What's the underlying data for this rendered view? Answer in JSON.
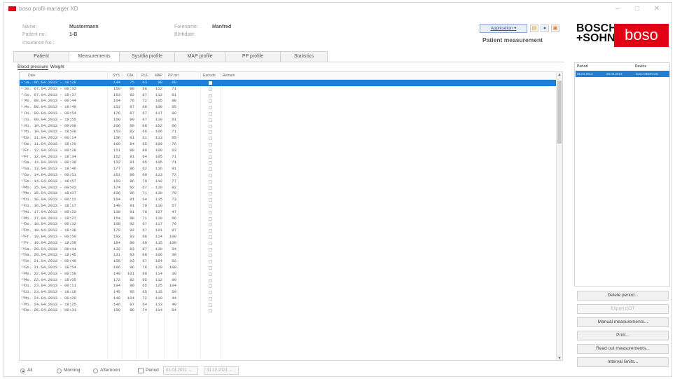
{
  "window": {
    "title": "boso profil-manager XD"
  },
  "patient": {
    "name_label": "Name:",
    "name_value": "Mustermann",
    "patient_no_label": "Patient no.:",
    "patient_no_value": "1-B",
    "insurance_label": "Insurance No.:",
    "forename_label": "Forename:",
    "forename_value": "Manfred",
    "birthdate_label": "Birthdate:"
  },
  "toolbar": {
    "application_label": "Application ▾",
    "section_title": "Patient measurement"
  },
  "brand": {
    "bosch_line1": "BOSCH",
    "bosch_line2": "+SOHN",
    "boso": "boso",
    "color": "#e20015"
  },
  "tabs": [
    "Patient",
    "Measurements",
    "Sys/dia profile",
    "MAP profile",
    "PP profile",
    "Statistics"
  ],
  "active_tab": "Measurements",
  "subtabs": {
    "blood_pressure": "Blood pressure",
    "weight": "Weight"
  },
  "table": {
    "columns": {
      "date": "Date",
      "sys": "SYS",
      "dia": "DIA",
      "pul": "PUL",
      "map": "MAP",
      "pp": "PP mm",
      "exclude": "Exclude",
      "remark": "Remark"
    },
    "rows": [
      {
        "idx": "1",
        "date": "Sa. 06.04.2013 - 10:28",
        "sys": "144",
        "dia": "75",
        "pul": "63",
        "map": "98",
        "pp": "69"
      },
      {
        "idx": "2",
        "date": "So. 07.04.2013 - 00:32",
        "sys": "159",
        "dia": "88",
        "pul": "68",
        "map": "112",
        "pp": "71"
      },
      {
        "idx": "3",
        "date": "So. 07.04.2013 - 18:37",
        "sys": "153",
        "dia": "92",
        "pul": "67",
        "map": "112",
        "pp": "61"
      },
      {
        "idx": "4",
        "date": "Mo. 08.04.2013 - 00:44",
        "sys": "164",
        "dia": "76",
        "pul": "72",
        "map": "105",
        "pp": "88"
      },
      {
        "idx": "5",
        "date": "Mo. 08.04.2013 - 18:49",
        "sys": "152",
        "dia": "87",
        "pul": "68",
        "map": "109",
        "pp": "65"
      },
      {
        "idx": "6",
        "date": "Di. 09.04.2013 - 00:54",
        "sys": "176",
        "dia": "87",
        "pul": "67",
        "map": "117",
        "pp": "89"
      },
      {
        "idx": "7",
        "date": "Di. 09.04.2013 - 18:55",
        "sys": "160",
        "dia": "99",
        "pul": "67",
        "map": "119",
        "pp": "61"
      },
      {
        "idx": "8",
        "date": "Mi. 10.04.2013 - 00:08",
        "sys": "166",
        "dia": "80",
        "pul": "68",
        "map": "102",
        "pp": "66"
      },
      {
        "idx": "9",
        "date": "Mi. 10.04.2013 - 18:09",
        "sys": "153",
        "dia": "82",
        "pul": "66",
        "map": "106",
        "pp": "71"
      },
      {
        "idx": "10",
        "date": "Do. 11.04.2013 - 00:14",
        "sys": "156",
        "dia": "91",
        "pul": "61",
        "map": "113",
        "pp": "65"
      },
      {
        "idx": "11",
        "date": "Do. 11.04.2013 - 18:20",
        "sys": "160",
        "dia": "84",
        "pul": "65",
        "map": "109",
        "pp": "76"
      },
      {
        "idx": "12",
        "date": "Fr. 12.04.2013 - 00:28",
        "sys": "151",
        "dia": "88",
        "pul": "80",
        "map": "109",
        "pp": "63"
      },
      {
        "idx": "13",
        "date": "Fr. 12.04.2013 - 18:34",
        "sys": "152",
        "dia": "81",
        "pul": "64",
        "map": "105",
        "pp": "71"
      },
      {
        "idx": "14",
        "date": "Sa. 13.04.2013 - 00:39",
        "sys": "152",
        "dia": "81",
        "pul": "65",
        "map": "105",
        "pp": "71"
      },
      {
        "idx": "15",
        "date": "Sa. 13.04.2013 - 18:46",
        "sys": "177",
        "dia": "86",
        "pul": "62",
        "map": "116",
        "pp": "91"
      },
      {
        "idx": "16",
        "date": "So. 14.04.2013 - 00:51",
        "sys": "161",
        "dia": "89",
        "pul": "60",
        "map": "113",
        "pp": "72"
      },
      {
        "idx": "17",
        "date": "So. 14.04.2013 - 18:57",
        "sys": "163",
        "dia": "86",
        "pul": "70",
        "map": "112",
        "pp": "77"
      },
      {
        "idx": "18",
        "date": "Mo. 15.04.2013 - 00:02",
        "sys": "174",
        "dia": "92",
        "pul": "67",
        "map": "119",
        "pp": "82"
      },
      {
        "idx": "19",
        "date": "Mo. 15.04.2013 - 18:07",
        "sys": "166",
        "dia": "96",
        "pul": "71",
        "map": "119",
        "pp": "70"
      },
      {
        "idx": "20",
        "date": "Di. 16.04.2013 - 00:12",
        "sys": "164",
        "dia": "91",
        "pul": "64",
        "map": "115",
        "pp": "73"
      },
      {
        "idx": "21",
        "date": "Di. 16.04.2013 - 18:17",
        "sys": "140",
        "dia": "91",
        "pul": "70",
        "map": "110",
        "pp": "57"
      },
      {
        "idx": "22",
        "date": "Mi. 17.04.2013 - 00:22",
        "sys": "138",
        "dia": "91",
        "pul": "70",
        "map": "107",
        "pp": "47"
      },
      {
        "idx": "23",
        "date": "Mi. 17.04.2013 - 18:27",
        "sys": "154",
        "dia": "88",
        "pul": "71",
        "map": "110",
        "pp": "66"
      },
      {
        "idx": "24",
        "date": "Do. 18.04.2013 - 00:32",
        "sys": "168",
        "dia": "92",
        "pul": "67",
        "map": "117",
        "pp": "76"
      },
      {
        "idx": "25",
        "date": "Do. 18.04.2013 - 18:38",
        "sys": "179",
        "dia": "92",
        "pul": "67",
        "map": "121",
        "pp": "87"
      },
      {
        "idx": "26",
        "date": "Fr. 19.04.2013 - 00:50",
        "sys": "192",
        "dia": "83",
        "pul": "66",
        "map": "114",
        "pp": "109"
      },
      {
        "idx": "27",
        "date": "Fr. 19.04.2013 - 18:58",
        "sys": "184",
        "dia": "80",
        "pul": "69",
        "map": "115",
        "pp": "108"
      },
      {
        "idx": "28",
        "date": "Sa. 20.04.2013 - 00:41",
        "sys": "132",
        "dia": "83",
        "pul": "67",
        "map": "119",
        "pp": "94"
      },
      {
        "idx": "29",
        "date": "Sa. 20.04.2013 - 18:45",
        "sys": "131",
        "dia": "93",
        "pul": "68",
        "map": "106",
        "pp": "38"
      },
      {
        "idx": "30",
        "date": "So. 21.04.2013 - 00:49",
        "sys": "155",
        "dia": "93",
        "pul": "67",
        "map": "104",
        "pp": "62"
      },
      {
        "idx": "31",
        "date": "So. 21.04.2013 - 18:54",
        "sys": "196",
        "dia": "96",
        "pul": "76",
        "map": "129",
        "pp": "100"
      },
      {
        "idx": "32",
        "date": "Mo. 22.04.2013 - 00:59",
        "sys": "140",
        "dia": "101",
        "pul": "60",
        "map": "114",
        "pp": "39"
      },
      {
        "idx": "33",
        "date": "Mo. 22.04.2013 - 18:05",
        "sys": "172",
        "dia": "82",
        "pul": "65",
        "map": "112",
        "pp": "90"
      },
      {
        "idx": "34",
        "date": "Di. 23.04.2013 - 00:11",
        "sys": "194",
        "dia": "90",
        "pul": "65",
        "map": "125",
        "pp": "104"
      },
      {
        "idx": "35",
        "date": "Di. 23.04.2013 - 18:16",
        "sys": "145",
        "dia": "95",
        "pul": "65",
        "map": "115",
        "pp": "50"
      },
      {
        "idx": "36",
        "date": "Mi. 24.04.2013 - 00:20",
        "sys": "148",
        "dia": "104",
        "pul": "72",
        "map": "119",
        "pp": "44"
      },
      {
        "idx": "37",
        "date": "Mi. 24.04.2013 - 18:25",
        "sys": "146",
        "dia": "97",
        "pul": "64",
        "map": "113",
        "pp": "49"
      },
      {
        "idx": "38",
        "date": "Do. 25.04.2013 - 00:31",
        "sys": "150",
        "dia": "96",
        "pul": "74",
        "map": "114",
        "pp": "54"
      }
    ]
  },
  "period_panel": {
    "col_period": "Period",
    "col_device": "Device",
    "row": {
      "from": "06.04.2013",
      "to": "25.04.2013",
      "device": "boso MEDICUS"
    }
  },
  "side_buttons": [
    {
      "label": "Delete period...",
      "enabled": true
    },
    {
      "label": "Export GDT",
      "enabled": false
    },
    {
      "label": "Manual measurements...",
      "enabled": true
    },
    {
      "label": "Print...",
      "enabled": true
    },
    {
      "label": "Read out measurements...",
      "enabled": true
    },
    {
      "label": "Interval limits...",
      "enabled": true
    }
  ],
  "filter": {
    "all": "All",
    "morning": "Morning",
    "afternoon": "Afternoon",
    "period": "Period",
    "date_from": "01.01.2021",
    "date_to": "31.12.2021",
    "selected": "All"
  },
  "colors": {
    "selection": "#1e7fd4",
    "brand_red": "#e20015"
  }
}
